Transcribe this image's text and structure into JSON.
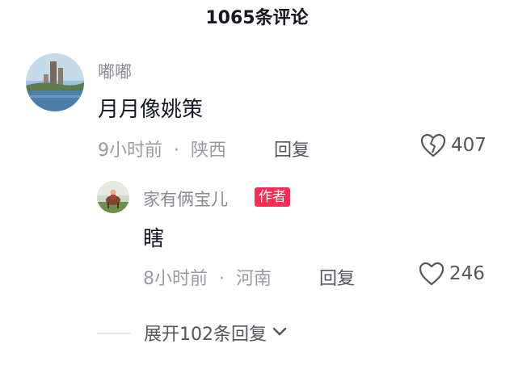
{
  "header": {
    "title": "1065条评论"
  },
  "comments": [
    {
      "username": "嘟嘟",
      "text": "月月像姚策",
      "time": "9小时前",
      "separator": "·",
      "location": "陕西",
      "reply_label": "回复",
      "likes": "407",
      "like_icon": "broken-heart-icon"
    }
  ],
  "reply": {
    "username": "家有俩宝儿",
    "badge": "作者",
    "text": "瞎",
    "time": "8小时前",
    "separator": "·",
    "location": "河南",
    "reply_label": "回复",
    "likes": "246",
    "like_icon": "heart-icon"
  },
  "expand": {
    "label": "展开102条回复",
    "icon": "chevron-down-icon"
  },
  "colors": {
    "badge": "#fe2c55",
    "text_primary": "#161823",
    "text_secondary": "#9a9ba1"
  }
}
